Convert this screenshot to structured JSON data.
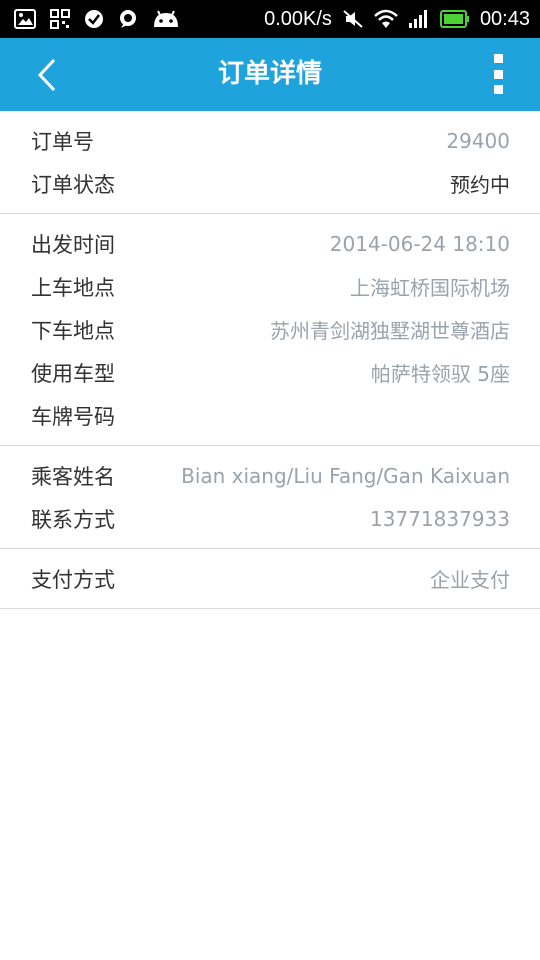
{
  "status_bar": {
    "icons_left": [
      "image-icon",
      "qr-code-icon",
      "check-circle-icon",
      "chat-bubble-icon",
      "android-icon"
    ],
    "net_speed": "0.00K/s",
    "time": "00:43",
    "battery_color": "#4cd137"
  },
  "app_bar": {
    "title": "订单详情",
    "background": "#1fa3dd"
  },
  "order": {
    "number_label": "订单号",
    "number_value": "29400",
    "status_label": "订单状态",
    "status_value": "预约中"
  },
  "trip": {
    "departure_label": "出发时间",
    "departure_value": "2014-06-24 18:10",
    "pickup_label": "上车地点",
    "pickup_value": "上海虹桥国际机场",
    "dropoff_label": "下车地点",
    "dropoff_value": "苏州青剑湖独墅湖世尊酒店",
    "car_type_label": "使用车型",
    "car_type_value": "帕萨特领驭 5座",
    "plate_label": "车牌号码",
    "plate_value": ""
  },
  "passenger": {
    "name_label": "乘客姓名",
    "name_value": "Bian xiang/Liu Fang/Gan Kaixuan",
    "contact_label": "联系方式",
    "contact_value": "13771837933"
  },
  "payment": {
    "method_label": "支付方式",
    "method_value": "企业支付"
  }
}
